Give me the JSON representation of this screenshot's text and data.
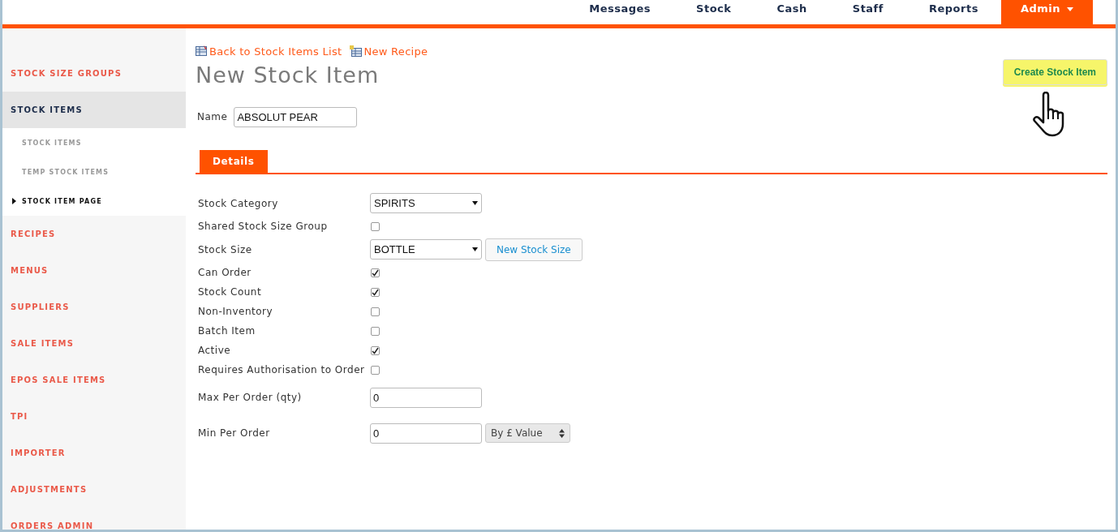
{
  "top_nav": [
    {
      "label": "Messages",
      "selected": false,
      "dropdown": false
    },
    {
      "label": "Stock",
      "selected": false,
      "dropdown": false
    },
    {
      "label": "Cash",
      "selected": false,
      "dropdown": false
    },
    {
      "label": "Staff",
      "selected": false,
      "dropdown": false
    },
    {
      "label": "Reports",
      "selected": false,
      "dropdown": false
    },
    {
      "label": "Admin",
      "selected": true,
      "dropdown": true
    }
  ],
  "sidebar": {
    "items": [
      {
        "label": "STOCK SIZE GROUPS",
        "selected": false
      },
      {
        "label": "STOCK ITEMS",
        "selected": true,
        "children": [
          {
            "label": "STOCK ITEMS",
            "selected": false
          },
          {
            "label": "TEMP STOCK ITEMS",
            "selected": false
          },
          {
            "label": "STOCK ITEM PAGE",
            "selected": true
          }
        ]
      },
      {
        "label": "RECIPES",
        "selected": false
      },
      {
        "label": "MENUS",
        "selected": false
      },
      {
        "label": "SUPPLIERS",
        "selected": false
      },
      {
        "label": "SALE ITEMS",
        "selected": false
      },
      {
        "label": "EPOS SALE ITEMS",
        "selected": false
      },
      {
        "label": "TPI",
        "selected": false
      },
      {
        "label": "IMPORTER",
        "selected": false
      },
      {
        "label": "ADJUSTMENTS",
        "selected": false
      },
      {
        "label": "ORDERS ADMIN",
        "selected": false
      }
    ]
  },
  "links": [
    "Back to Stock Items List",
    "New Recipe"
  ],
  "page_title": "New Stock Item",
  "primary_button": "Create Stock Item",
  "name_field": {
    "label": "Name",
    "value": "ABSOLUT PEAR"
  },
  "tabs": [
    {
      "label": "Details",
      "selected": true
    }
  ],
  "fields": [
    {
      "kind": "select",
      "label": "Stock Category",
      "value": "SPIRITS"
    },
    {
      "kind": "checkbox",
      "label": "Shared Stock Size Group",
      "checked": false
    },
    {
      "kind": "select",
      "label": "Stock Size",
      "value": "BOTTLE",
      "button": "New Stock Size"
    },
    {
      "kind": "checkbox",
      "label": "Can Order",
      "checked": true
    },
    {
      "kind": "checkbox",
      "label": "Stock Count",
      "checked": true
    },
    {
      "kind": "checkbox",
      "label": "Non-Inventory",
      "checked": false
    },
    {
      "kind": "checkbox",
      "label": "Batch Item",
      "checked": false
    },
    {
      "kind": "checkbox",
      "label": "Active",
      "checked": true
    },
    {
      "kind": "checkbox",
      "label": "Requires Authorisation to Order",
      "checked": false
    },
    {
      "kind": "text",
      "label": "Max Per Order (qty)",
      "value": "0"
    },
    {
      "kind": "text",
      "label": "Min Per Order",
      "value": "0",
      "unit": "By £ Value"
    }
  ]
}
